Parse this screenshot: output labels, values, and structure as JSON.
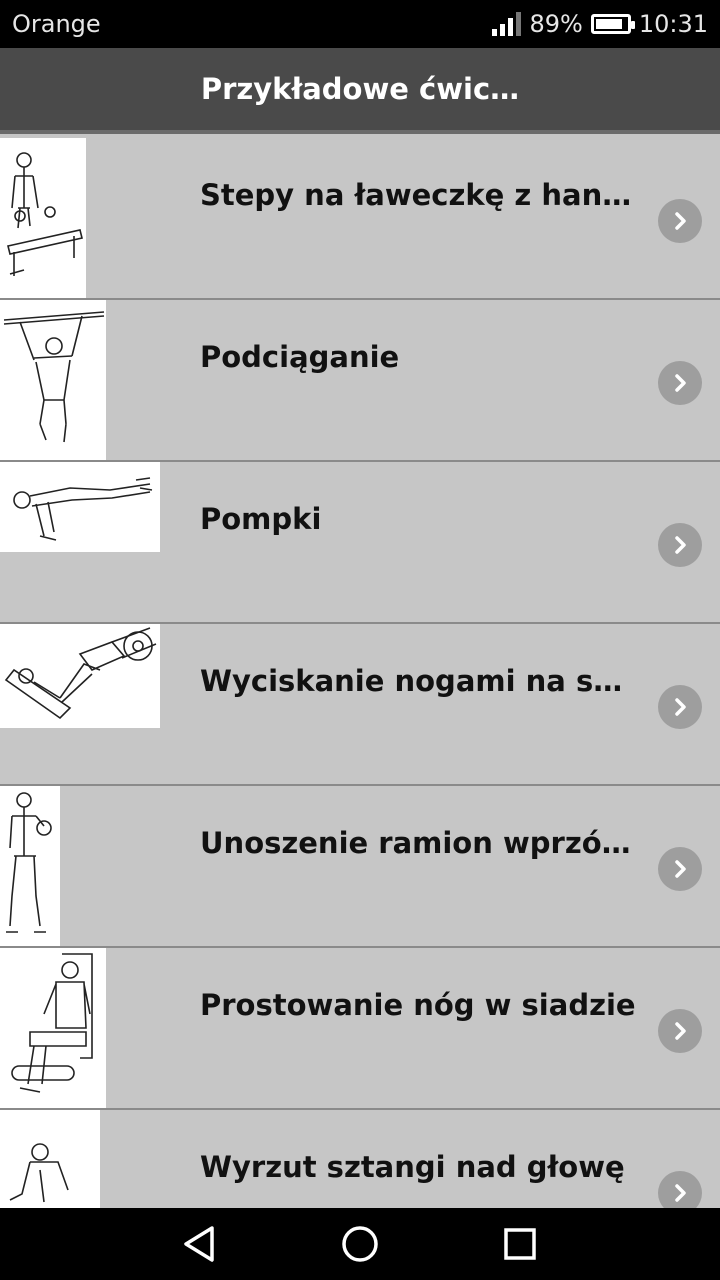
{
  "status": {
    "carrier": "Orange",
    "battery_percent_label": "89%",
    "battery_level": 0.89,
    "time": "10:31",
    "signal_bars_filled": 3
  },
  "app_bar": {
    "title": "Przykładowe ćwic…"
  },
  "exercises": [
    {
      "title": "Stepy na ławeczkę z hantlami",
      "thumb_icon": "bench-step-dumbbell-illustration"
    },
    {
      "title": "Podciąganie",
      "thumb_icon": "pull-up-illustration"
    },
    {
      "title": "Pompki",
      "thumb_icon": "push-up-illustration"
    },
    {
      "title": "Wyciskanie nogami na suwni…",
      "thumb_icon": "leg-press-illustration"
    },
    {
      "title": "Unoszenie ramion wprzód z …",
      "thumb_icon": "front-raise-illustration"
    },
    {
      "title": "Prostowanie nóg w siadzie",
      "thumb_icon": "leg-extension-illustration"
    },
    {
      "title": "Wyrzut sztangi nad głowę",
      "thumb_icon": "barbell-throw-illustration"
    }
  ],
  "navigation": {
    "back_icon": "back-triangle-icon",
    "home_icon": "home-circle-icon",
    "recents_icon": "recents-square-icon"
  },
  "colors": {
    "status_bar": "#000000",
    "app_bar": "#4a4a4a",
    "list_background": "#c6c6c6",
    "chevron_badge": "#9e9e9e"
  }
}
